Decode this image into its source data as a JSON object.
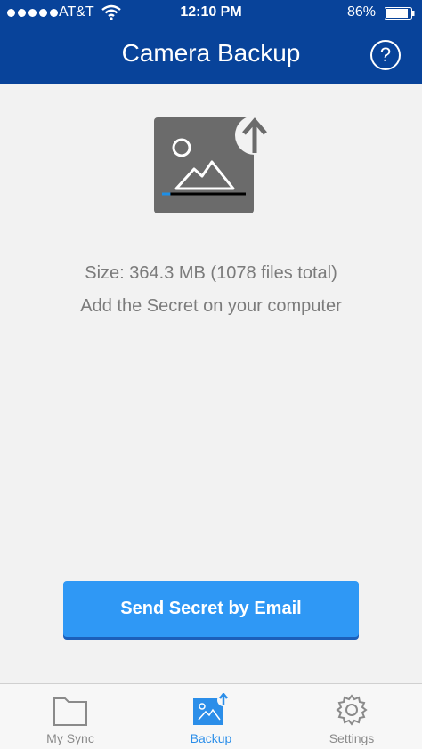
{
  "status_bar": {
    "carrier": "AT&T",
    "time": "12:10 PM",
    "battery": "86%"
  },
  "header": {
    "title": "Camera Backup",
    "help_label": "?"
  },
  "backup": {
    "size_text": "Size: 364.3 MB (1078 files total)",
    "hint_text": "Add the Secret on your computer",
    "progress": 0.1,
    "send_button_label": "Send Secret by Email"
  },
  "tabs": [
    {
      "label": "My Sync",
      "icon": "folder-icon",
      "active": false
    },
    {
      "label": "Backup",
      "icon": "photo-upload-icon",
      "active": true
    },
    {
      "label": "Settings",
      "icon": "gear-icon",
      "active": false
    }
  ],
  "colors": {
    "header": "#08439a",
    "accent": "#2f98f5",
    "active_tab": "#2b8ee9",
    "inactive": "#8a8a8a"
  }
}
